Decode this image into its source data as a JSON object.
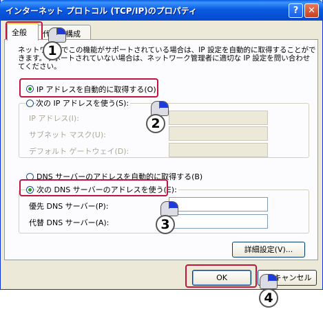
{
  "window": {
    "title": "インターネット プロトコル (TCP/IP)のプロパティ",
    "help_glyph": "?",
    "close_glyph": "✕"
  },
  "tabs": [
    {
      "label": "全般",
      "active": true
    },
    {
      "label": "代替の構成",
      "active": false
    }
  ],
  "description": [
    "ネットワークでこの機能がサポートされている場合は、IP 設定を自動的に取得することがで",
    "きます。サポートされていない場合は、ネットワーク管理者に適切な IP 設定を問い合わせ",
    "てください。"
  ],
  "ip": {
    "auto_label": "IP アドレスを自動的に取得する(O)",
    "auto_selected": true,
    "manual_label": "次の IP アドレスを使う(S):",
    "manual_selected": false,
    "fields": [
      {
        "label": "IP アドレス(I):",
        "value": ""
      },
      {
        "label": "サブネット マスク(U):",
        "value": ""
      },
      {
        "label": "デフォルト ゲートウェイ(D):",
        "value": ""
      }
    ]
  },
  "dns": {
    "auto_label": "DNS サーバーのアドレスを自動的に取得する(B)",
    "auto_selected": false,
    "manual_label": "次の DNS サーバーのアドレスを使う(E):",
    "manual_selected": true,
    "fields": [
      {
        "label": "優先 DNS サーバー(P):",
        "value": ""
      },
      {
        "label": "代替 DNS サーバー(A):",
        "value": ""
      }
    ]
  },
  "buttons": {
    "advanced": "詳細設定(V)...",
    "ok": "OK",
    "cancel": "キャンセル"
  },
  "steps": [
    "1",
    "2",
    "3",
    "4"
  ],
  "colors": {
    "highlight": "#c0143c",
    "title_bar": "#0a5be0",
    "dialog_bg": "#ece9d8",
    "radio_dot": "#21a121",
    "mouse_button": "#1f3ad8"
  }
}
